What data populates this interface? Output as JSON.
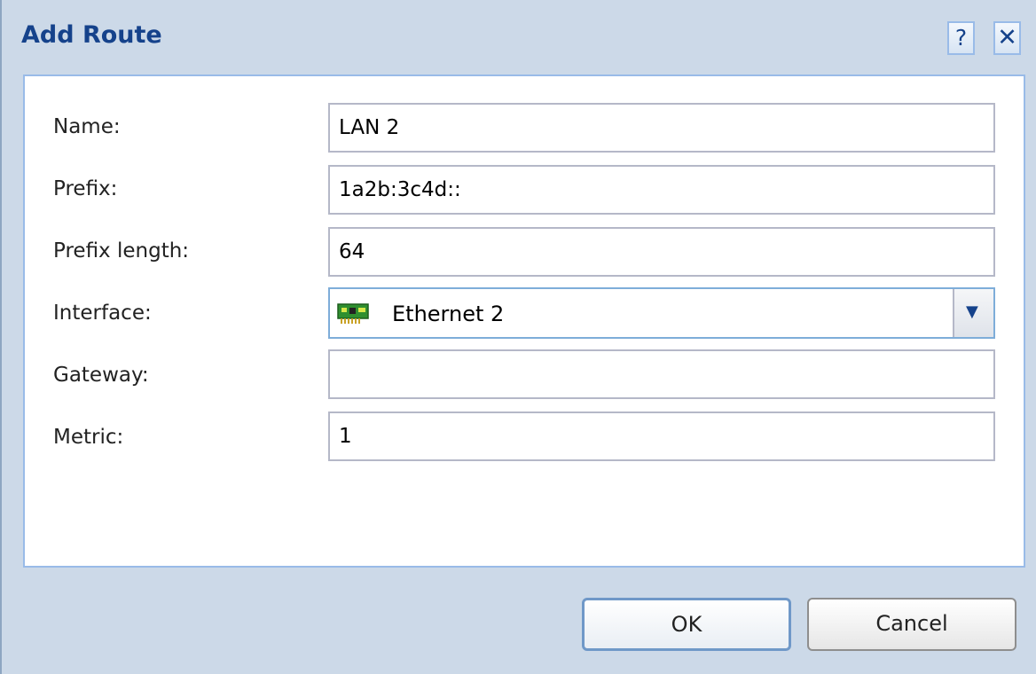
{
  "window": {
    "title": "Add Route",
    "help_label": "?",
    "close_label": "✕"
  },
  "form": {
    "name": {
      "label": "Name:",
      "value": "LAN 2"
    },
    "prefix": {
      "label": "Prefix:",
      "value": "1a2b:3c4d::"
    },
    "prefix_length": {
      "label": "Prefix length:",
      "value": "64"
    },
    "interface": {
      "label": "Interface:",
      "value": "Ethernet 2",
      "icon": "network-card-icon"
    },
    "gateway": {
      "label": "Gateway:",
      "value": ""
    },
    "metric": {
      "label": "Metric:",
      "value": "1"
    }
  },
  "buttons": {
    "ok_label": "OK",
    "cancel_label": "Cancel"
  },
  "colors": {
    "title": "#15428b",
    "frame": "#ccd9e8",
    "border": "#99bbe8"
  }
}
